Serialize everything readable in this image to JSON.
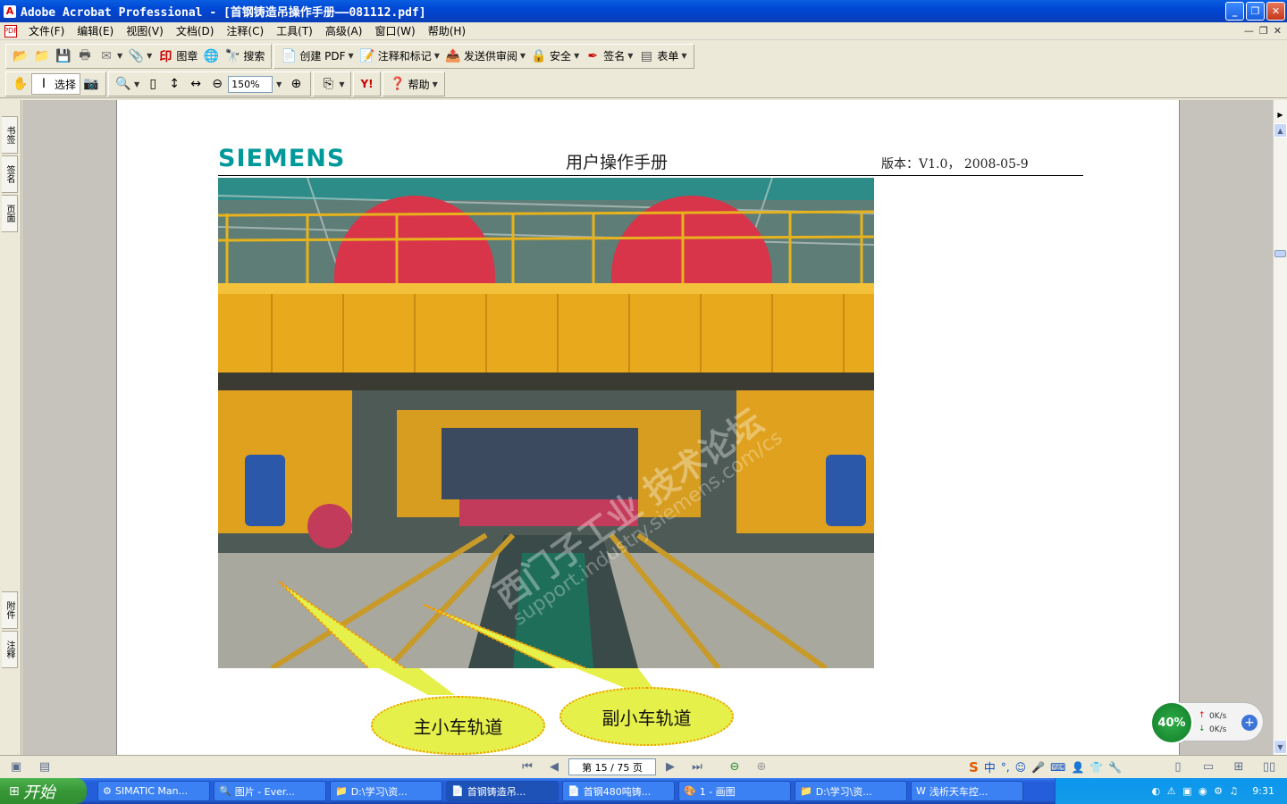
{
  "window": {
    "title": "Adobe Acrobat Professional - [首钢铸造吊操作手册——081112.pdf]",
    "minimize": "_",
    "restore": "❐",
    "close": "✕"
  },
  "menu": {
    "items": [
      "文件(F)",
      "编辑(E)",
      "视图(V)",
      "文档(D)",
      "注释(C)",
      "工具(T)",
      "高级(A)",
      "窗口(W)",
      "帮助(H)"
    ]
  },
  "toolbar1": {
    "stamp_label": "图章",
    "search_label": "搜索",
    "create_pdf_label": "创建 PDF",
    "comment_label": "注释和标记",
    "send_review_label": "发送供审阅",
    "security_label": "安全",
    "sign_label": "签名",
    "forms_label": "表单"
  },
  "toolbar2": {
    "select_label": "选择",
    "zoom_value": "150%",
    "help_label": "帮助",
    "yahoo_label": "Y!"
  },
  "left_tabs": {
    "bookmarks": "书签",
    "signatures": "签名",
    "pages": "页面",
    "attachments": "附件",
    "comments": "注释"
  },
  "document": {
    "logo": "SIEMENS",
    "title": "用户操作手册",
    "version": "版本：V1.0，  2008-05-9",
    "watermark_cn": "西门子工业  技术论坛",
    "watermark_url": "support.industry.siemens.com/cs",
    "callout_main": "主小车轨道",
    "callout_aux": "副小车轨道"
  },
  "statusbar": {
    "page_indicator": "第 15 / 75 页"
  },
  "net_widget": {
    "percent": "40%",
    "up": "0K/s",
    "down": "0K/s"
  },
  "taskbar": {
    "start_label": "开始",
    "tasks": [
      "SIMATIC Man...",
      "图片 - Ever...",
      "D:\\学习\\资...",
      "首钢铸造吊...",
      "首钢480吨铸...",
      "1 - 画图",
      "D:\\学习\\资...",
      "浅析天车控..."
    ],
    "clock": "9:31"
  },
  "colors": {
    "siemens_teal": "#009999",
    "callout_fill": "#e6f04a",
    "callout_border": "#f09a00"
  }
}
